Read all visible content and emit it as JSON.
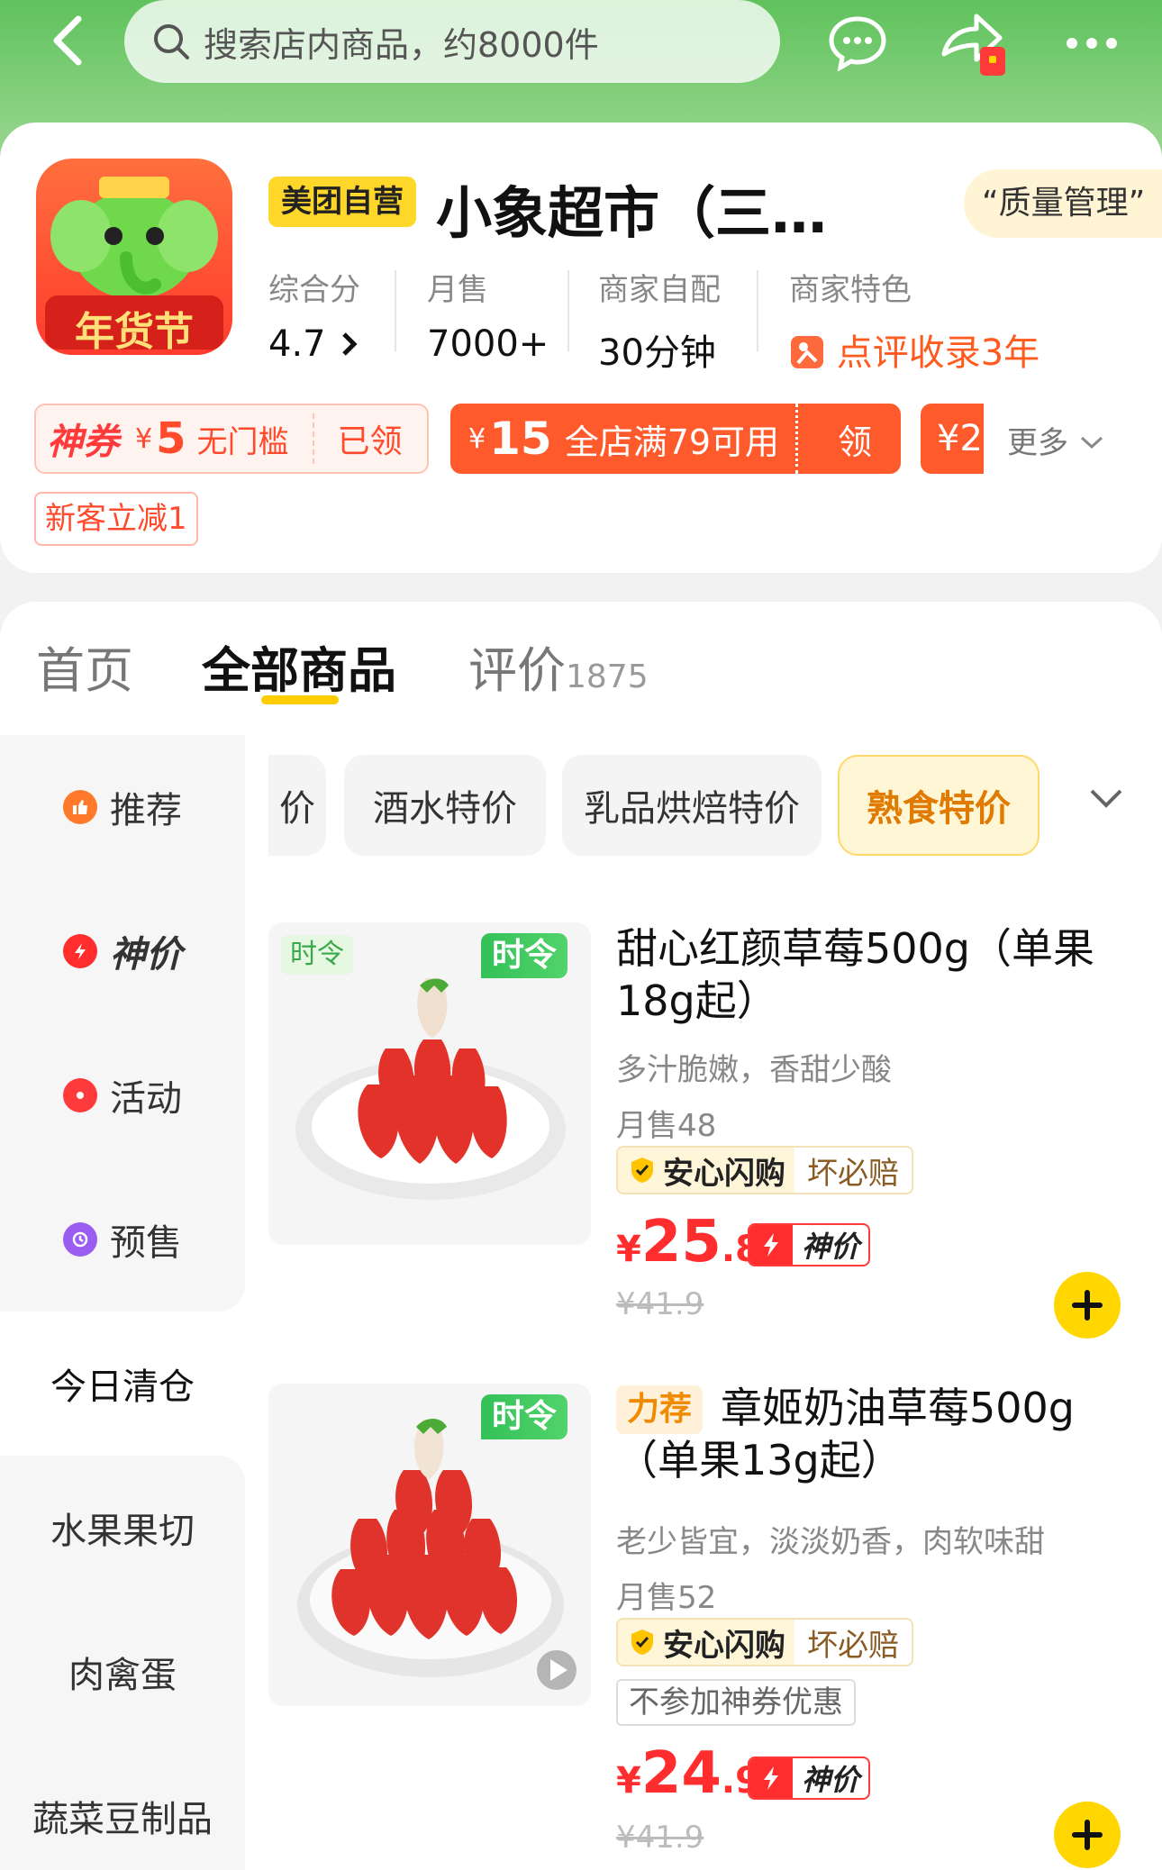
{
  "header": {
    "search_placeholder": "搜索店内商品，约8000件"
  },
  "shop": {
    "badge": "美团自营",
    "name": "小象超市（三…",
    "quality_tag": "“质量管理”",
    "logo_text": "年货节",
    "stats": [
      {
        "label": "综合分",
        "value": "4.7"
      },
      {
        "label": "月售",
        "value": "7000+"
      },
      {
        "label": "商家自配",
        "value": "30分钟"
      },
      {
        "label": "商家特色",
        "value": "点评收录3年"
      }
    ],
    "coupons": {
      "c1_brand": "神券",
      "c1_cur": "¥",
      "c1_amount": "5",
      "c1_desc": "无门槛",
      "c1_state": "已领",
      "c2_cur": "¥",
      "c2_amount": "15",
      "c2_desc": "全店满79可用",
      "c2_action": "领",
      "c3_partial": "¥2",
      "more": "更多"
    },
    "new_customer": "新客立减1"
  },
  "tabs": [
    {
      "label": "首页"
    },
    {
      "label": "全部商品"
    },
    {
      "label": "评价",
      "count": "1875"
    }
  ],
  "sidebar": {
    "items": [
      {
        "label": "推荐"
      },
      {
        "label": "神价"
      },
      {
        "label": "活动"
      },
      {
        "label": "预售"
      },
      {
        "label": "今日清仓"
      },
      {
        "label": "水果果切"
      },
      {
        "label": "肉禽蛋"
      },
      {
        "label": "蔬菜豆制品"
      }
    ]
  },
  "chips": [
    {
      "label": "价"
    },
    {
      "label": "酒水特价"
    },
    {
      "label": "乳品烘焙特价"
    },
    {
      "label": "熟食特价"
    }
  ],
  "products": [
    {
      "corner_tag": "时令",
      "season_tag": "时令",
      "title": "甜心红颜草莓500g（单果18g起）",
      "subtitle": "多汁脆嫩，香甜少酸",
      "sales": "月售48",
      "safe_label": "安心闪购",
      "safe_promise": "坏必赔",
      "price_cur": "¥",
      "price_int": "25",
      "price_dec": ".8",
      "flash_label": "神价",
      "orig_price": "¥41.9"
    },
    {
      "season_tag": "时令",
      "recommend": "力荐",
      "title": "章姬奶油草莓500g（单果13g起）",
      "subtitle": "老少皆宜，淡淡奶香，肉软味甜",
      "sales": "月售52",
      "safe_label": "安心闪购",
      "safe_promise": "坏必赔",
      "no_coupon": "不参加神券优惠",
      "price_cur": "¥",
      "price_int": "24",
      "price_dec": ".9",
      "flash_label": "神价",
      "orig_price": "¥41.9"
    }
  ],
  "colors": {
    "accent_yellow": "#ffd600",
    "price_red": "#ff2d2d",
    "coupon_orange": "#ff5a2b",
    "green_header": "#5fc25c"
  }
}
